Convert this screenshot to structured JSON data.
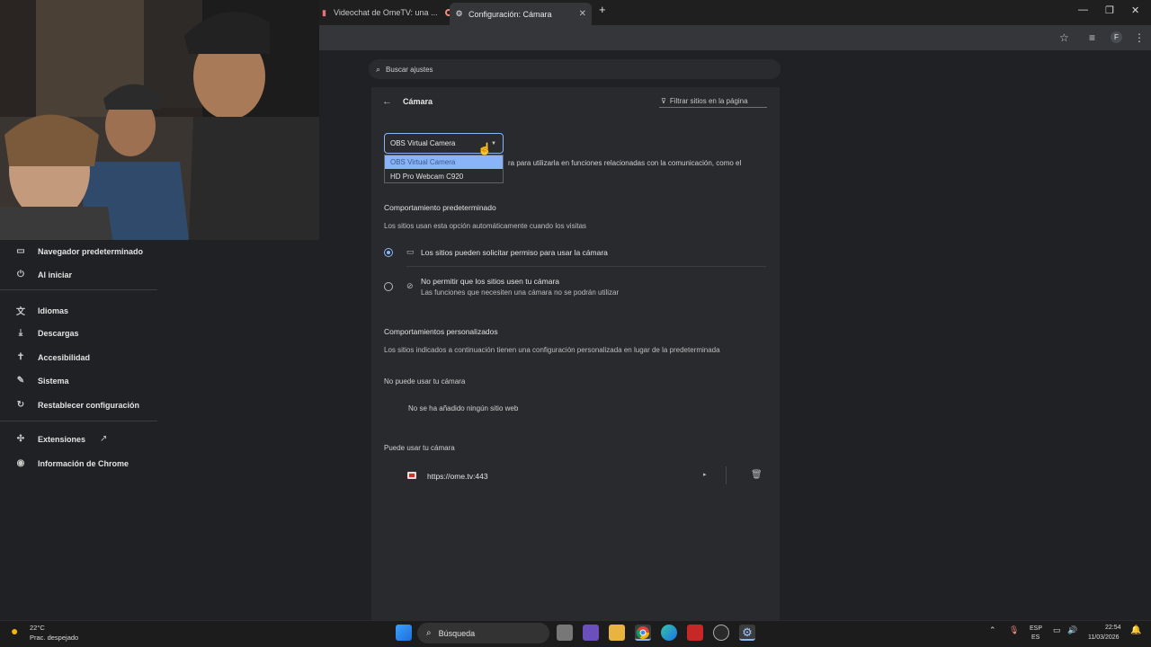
{
  "browser": {
    "tabs": [
      {
        "label": "Videochat de OmeTV: una ..."
      },
      {
        "label": "Configuración: Cámara"
      }
    ],
    "profile_initial": "F"
  },
  "search": {
    "placeholder": "Buscar ajustes"
  },
  "sidebar": {
    "items": [
      {
        "label": "Navegador predeterminado",
        "icon": "browser-icon"
      },
      {
        "label": "Al iniciar",
        "icon": "power-icon"
      },
      {
        "label": "Idiomas",
        "icon": "translate-icon"
      },
      {
        "label": "Descargas",
        "icon": "download-icon"
      },
      {
        "label": "Accesibilidad",
        "icon": "accessibility-icon"
      },
      {
        "label": "Sistema",
        "icon": "wrench-icon"
      },
      {
        "label": "Restablecer configuración",
        "icon": "reset-icon"
      },
      {
        "label": "Extensiones",
        "icon": "puzzle-icon"
      },
      {
        "label": "Información de Chrome",
        "icon": "chrome-icon"
      }
    ]
  },
  "camera": {
    "title": "Cámara",
    "filter_label": "Filtrar sitios en la página",
    "selected_device": "OBS Virtual Camera",
    "options": [
      "OBS Virtual Camera",
      "HD Pro Webcam C920"
    ],
    "description_fragment": "ra para utilizarla en funciones relacionadas con la comunicación, como el",
    "default_behavior": {
      "title": "Comportamiento predeterminado",
      "subtitle": "Los sitios usan esta opción automáticamente cuando los visitas",
      "allow_label": "Los sitios pueden solicitar permiso para usar la cámara",
      "block_label": "No permitir que los sitios usen tu cámara",
      "block_sub": "Las funciones que necesiten una cámara no se podrán utilizar"
    },
    "custom": {
      "title": "Comportamientos personalizados",
      "subtitle": "Los sitios indicados a continuación tienen una configuración personalizada en lugar de la predeterminada",
      "blocked_title": "No puede usar tu cámara",
      "blocked_empty": "No se ha añadido ningún sitio web",
      "allowed_title": "Puede usar tu cámara",
      "allowed_site": "https://ome.tv:443"
    }
  },
  "taskbar": {
    "weather_temp": "22°C",
    "weather_desc": "Prac. despejado",
    "search_label": "Búsqueda",
    "lang_top": "ESP",
    "lang_bottom": "ES",
    "time": "22:54",
    "date": "11/03/2026"
  }
}
